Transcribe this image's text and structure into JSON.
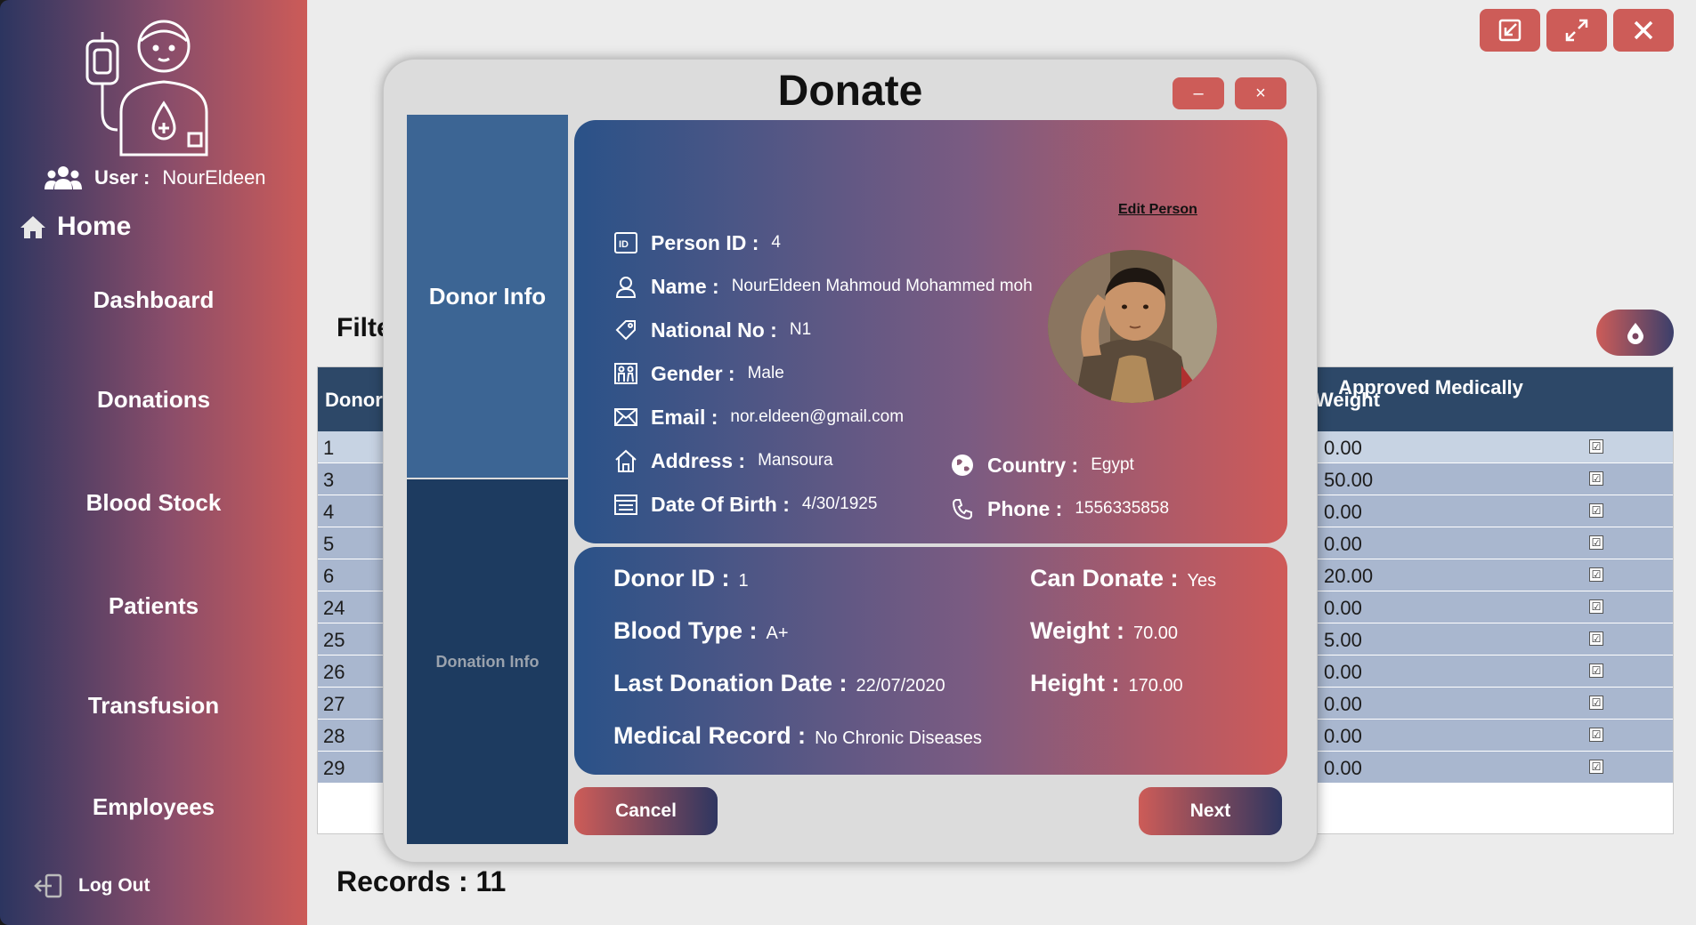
{
  "sidebar": {
    "user_label": "User :",
    "user_name": "NourEldeen",
    "home": "Home",
    "items": [
      "Dashboard",
      "Donations",
      "Blood Stock",
      "Patients",
      "Transfusion",
      "Employees"
    ],
    "logout": "Log Out"
  },
  "main": {
    "filter_title": "Filte",
    "grid": {
      "headers": {
        "donor": "Donor",
        "weight": "Weight",
        "approved": "Approved Medically"
      },
      "rows": [
        {
          "id": "1",
          "weight": "0.00"
        },
        {
          "id": "3",
          "weight": "50.00"
        },
        {
          "id": "4",
          "weight": "0.00"
        },
        {
          "id": "5",
          "weight": "0.00"
        },
        {
          "id": "6",
          "weight": "20.00"
        },
        {
          "id": "24",
          "weight": "0.00"
        },
        {
          "id": "25",
          "weight": "5.00"
        },
        {
          "id": "26",
          "weight": "0.00"
        },
        {
          "id": "27",
          "weight": "0.00"
        },
        {
          "id": "28",
          "weight": "0.00"
        },
        {
          "id": "29",
          "weight": "0.00"
        }
      ],
      "check_mark": "☑"
    },
    "records": "Records : 11"
  },
  "modal": {
    "title": "Donate",
    "minimize": "–",
    "close": "×",
    "tabs": {
      "donor_info": "Donor Info",
      "donation_info": "Donation Info"
    },
    "edit_person": "Edit Person",
    "person": {
      "id_label": "Person ID :",
      "id": "4",
      "name_label": "Name :",
      "name": "NourEldeen Mahmoud Mohammed moh",
      "national_label": "National No :",
      "national": "N1",
      "gender_label": "Gender :",
      "gender": "Male",
      "email_label": "Email :",
      "email": "nor.eldeen@gmail.com",
      "address_label": "Address :",
      "address": "Mansoura",
      "dob_label": "Date Of Birth :",
      "dob": "4/30/1925",
      "country_label": "Country :",
      "country": "Egypt",
      "phone_label": "Phone :",
      "phone": "1556335858"
    },
    "donor": {
      "donor_id_label": "Donor ID :",
      "donor_id": "1",
      "blood_type_label": "Blood Type  :",
      "blood_type": "A+",
      "last_date_label": "Last Donation Date  :",
      "last_date": "22/07/2020",
      "medical_label": "Medical Record  :",
      "medical": "No Chronic Diseases",
      "can_donate_label": "Can Donate  :",
      "can_donate": "Yes",
      "weight_label": "Weight :",
      "weight": "70.00",
      "height_label": "Height :",
      "height": "170.00"
    },
    "cancel": "Cancel",
    "next": "Next"
  },
  "colors": {
    "accent_red": "#cd5c58",
    "navy": "#2d4868",
    "sidebar_blue": "#3c6594"
  }
}
